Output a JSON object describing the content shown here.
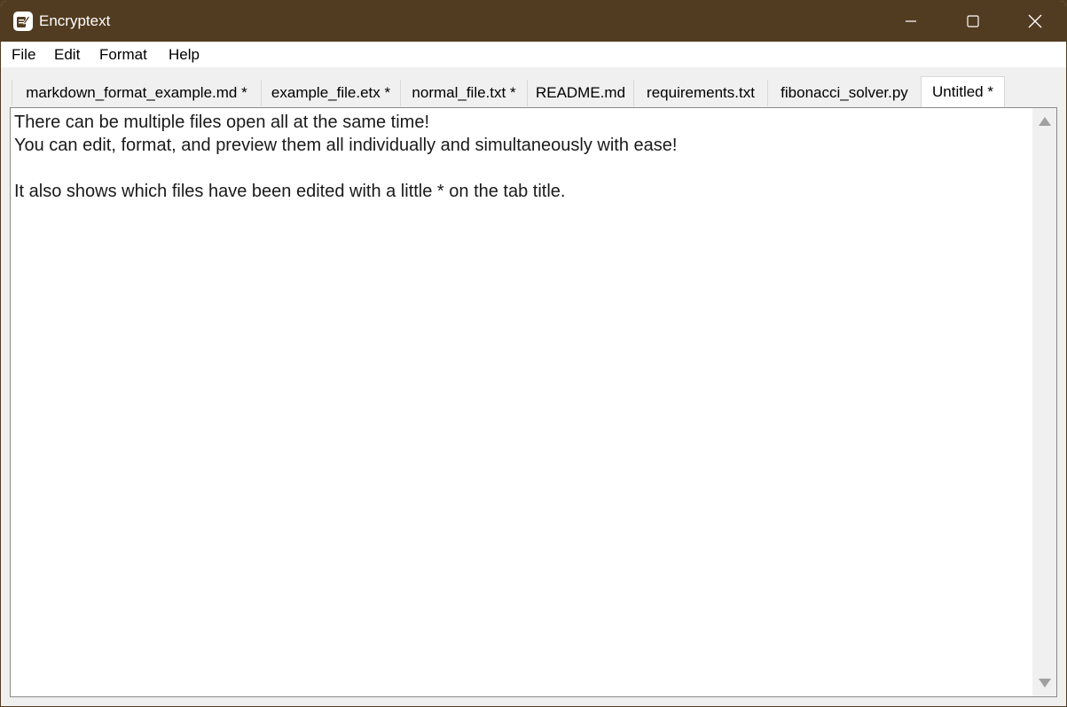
{
  "window": {
    "title": "Encryptext",
    "title_bar_color": "#523c21"
  },
  "menu": {
    "items": [
      "File",
      "Edit",
      "Format",
      "Help"
    ]
  },
  "tabs": [
    {
      "label": "markdown_format_example.md *",
      "active": false
    },
    {
      "label": "example_file.etx *",
      "active": false
    },
    {
      "label": "normal_file.txt *",
      "active": false
    },
    {
      "label": "README.md",
      "active": false
    },
    {
      "label": "requirements.txt",
      "active": false
    },
    {
      "label": "fibonacci_solver.py",
      "active": false
    },
    {
      "label": "Untitled *",
      "active": true
    }
  ],
  "editor": {
    "lines": [
      "There can be multiple files open all at the same time!",
      "You can edit, format, and preview them all individually and simultaneously with ease!",
      "",
      "It also shows which files have been edited with a little * on the tab title."
    ]
  },
  "icons": {
    "app": "notepad-pencil-icon",
    "minimize": "minimize-icon",
    "maximize": "maximize-icon",
    "close": "close-icon",
    "scroll_up": "scroll-up-arrow-icon",
    "scroll_down": "scroll-down-arrow-icon"
  }
}
